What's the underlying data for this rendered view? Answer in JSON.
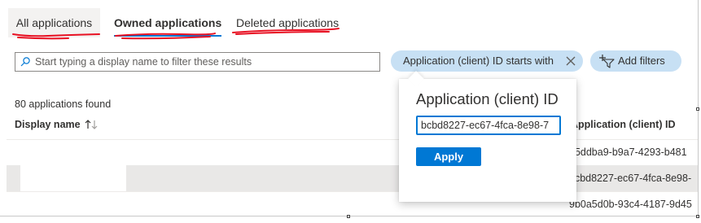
{
  "tabs": {
    "all": "All applications",
    "owned": "Owned applications",
    "deleted": "Deleted applications"
  },
  "search": {
    "placeholder": "Start typing a display name to filter these results",
    "value": ""
  },
  "filter_pill": {
    "label": "Application (client) ID starts with"
  },
  "add_filters": {
    "label": "Add filters"
  },
  "list": {
    "count": "80 applications found",
    "columns": {
      "display_name": "Display name",
      "app_id": "Application (client) ID"
    },
    "rows": [
      {
        "display_name": "",
        "app_id": "25ddba9-b9a7-4293-b481"
      },
      {
        "display_name": "",
        "app_id": "bcbd8227-ec67-4fca-8e98-"
      },
      {
        "display_name": "",
        "app_id": "9b0a5d0b-93c4-4187-9d45"
      }
    ]
  },
  "popup": {
    "title": "Application (client) ID",
    "input_value": "bcbd8227-ec67-4fca-8e98-7",
    "apply_label": "Apply"
  },
  "colors": {
    "accent": "#0078d4",
    "pill_bg": "#c7e0f4",
    "annotation_red": "#e81123",
    "row_highlight": "#e9e8e7"
  },
  "icons": [
    "search-icon",
    "close-icon",
    "add-filter-icon",
    "sort-icon"
  ]
}
